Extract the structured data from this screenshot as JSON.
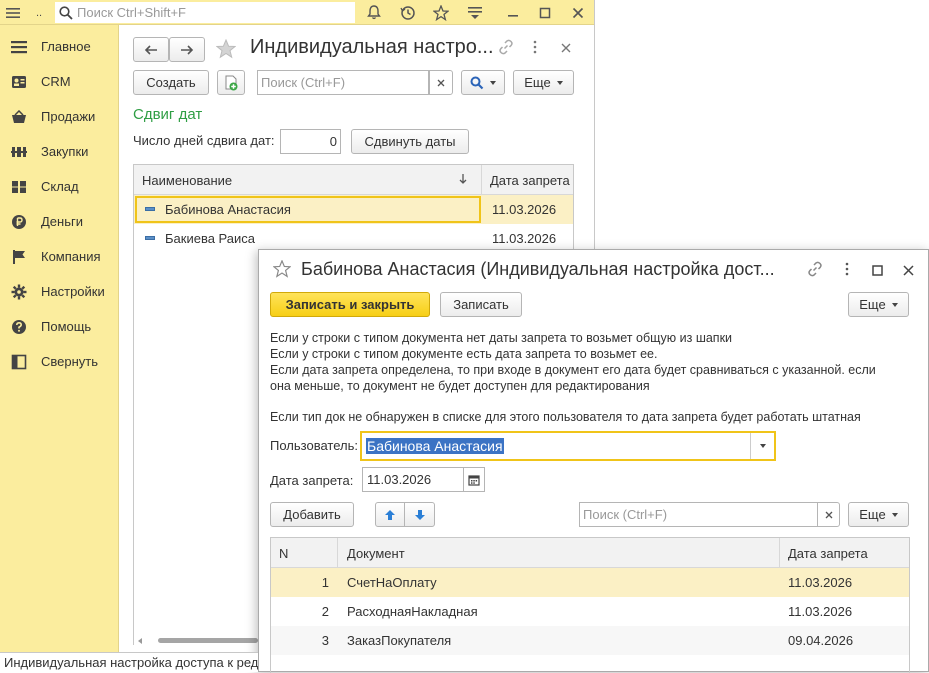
{
  "topbar": {
    "search_placeholder": "Поиск Ctrl+Shift+F",
    "dots_label": ".."
  },
  "sidebar": {
    "items": [
      {
        "label": "Главное",
        "icon": "menu-icon"
      },
      {
        "label": "CRM",
        "icon": "crm-icon"
      },
      {
        "label": "Продажи",
        "icon": "basket-icon"
      },
      {
        "label": "Закупки",
        "icon": "purchases-icon"
      },
      {
        "label": "Склад",
        "icon": "warehouse-icon"
      },
      {
        "label": "Деньги",
        "icon": "money-icon"
      },
      {
        "label": "Компания",
        "icon": "flag-icon"
      },
      {
        "label": "Настройки",
        "icon": "gear-icon"
      },
      {
        "label": "Помощь",
        "icon": "help-icon"
      },
      {
        "label": "Свернуть",
        "icon": "collapse-icon"
      }
    ]
  },
  "window1": {
    "title": "Индивидуальная настро...",
    "create_label": "Создать",
    "search_placeholder": "Поиск (Ctrl+F)",
    "more_label": "Еще",
    "section_title": "Сдвиг дат",
    "days_label": "Число дней сдвига дат:",
    "days_value": "0",
    "shift_button": "Сдвинуть даты",
    "columns": {
      "name": "Наименование",
      "date": "Дата запрета"
    },
    "rows": [
      {
        "name": "Бабинова Анастасия",
        "date": "11.03.2026"
      },
      {
        "name": "Бакиева Раиса",
        "date": "11.03.2026"
      }
    ]
  },
  "window2": {
    "title": "Бабинова Анастасия (Индивидуальная настройка дост...",
    "save_close_label": "Записать и закрыть",
    "save_label": "Записать",
    "more_label": "Еще",
    "info_lines": [
      "Если у строки с типом документа нет даты запрета то возьмет общую из шапки",
      "Если у строки с типом документе есть дата запрета то возьмет ее.",
      "Если дата запрета определена, то при входе в документ его дата будет сравниваться с указанной. если",
      "она меньше, то документ не будет доступен для редактирования"
    ],
    "info_line2": "Если тип док не обнаружен в списке для этого пользователя  то дата запрета будет работать штатная",
    "user_label": "Пользователь:",
    "user_value": "Бабинова Анастасия",
    "date_label": "Дата запрета:",
    "date_value": "11.03.2026",
    "add_label": "Добавить",
    "search_placeholder": "Поиск (Ctrl+F)",
    "table_more_label": "Еще",
    "columns": {
      "n": "N",
      "doc": "Документ",
      "date": "Дата запрета"
    },
    "rows": [
      {
        "n": "1",
        "doc": "СчетНаОплату",
        "date": "11.03.2026"
      },
      {
        "n": "2",
        "doc": "РасходнаяНакладная",
        "date": "11.03.2026"
      },
      {
        "n": "3",
        "doc": "ЗаказПокупателя",
        "date": "09.04.2026"
      }
    ]
  },
  "statusbar": {
    "text": "Индивидуальная настройка доступа к редактированию"
  },
  "colors": {
    "sidebar_bg": "#fbed9e",
    "accent_green": "#2f9e44",
    "primary_button": "#fcd733",
    "selected_row": "#fbf0c5",
    "focus_border": "#f0c419"
  }
}
